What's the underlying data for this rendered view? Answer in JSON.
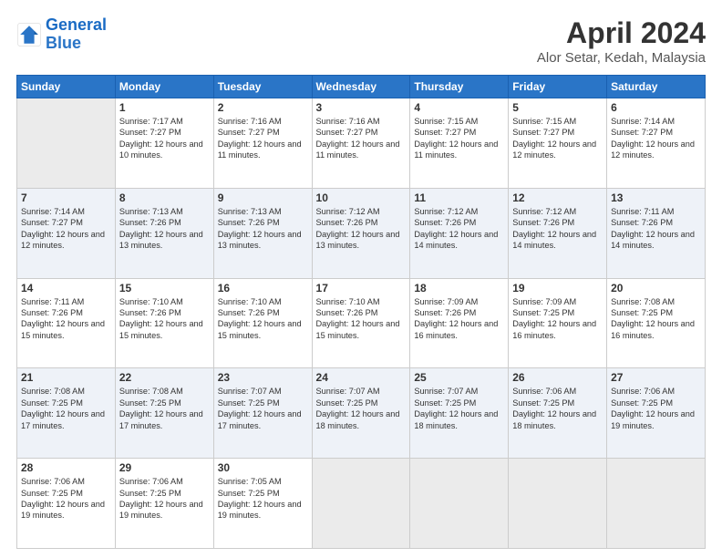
{
  "header": {
    "logo_general": "General",
    "logo_blue": "Blue",
    "title": "April 2024",
    "subtitle": "Alor Setar, Kedah, Malaysia"
  },
  "weekdays": [
    "Sunday",
    "Monday",
    "Tuesday",
    "Wednesday",
    "Thursday",
    "Friday",
    "Saturday"
  ],
  "weeks": [
    [
      {
        "day": "",
        "empty": true
      },
      {
        "day": "1",
        "sunrise": "7:17 AM",
        "sunset": "7:27 PM",
        "daylight": "12 hours and 10 minutes."
      },
      {
        "day": "2",
        "sunrise": "7:16 AM",
        "sunset": "7:27 PM",
        "daylight": "12 hours and 11 minutes."
      },
      {
        "day": "3",
        "sunrise": "7:16 AM",
        "sunset": "7:27 PM",
        "daylight": "12 hours and 11 minutes."
      },
      {
        "day": "4",
        "sunrise": "7:15 AM",
        "sunset": "7:27 PM",
        "daylight": "12 hours and 11 minutes."
      },
      {
        "day": "5",
        "sunrise": "7:15 AM",
        "sunset": "7:27 PM",
        "daylight": "12 hours and 12 minutes."
      },
      {
        "day": "6",
        "sunrise": "7:14 AM",
        "sunset": "7:27 PM",
        "daylight": "12 hours and 12 minutes."
      }
    ],
    [
      {
        "day": "7",
        "sunrise": "7:14 AM",
        "sunset": "7:27 PM",
        "daylight": "12 hours and 12 minutes."
      },
      {
        "day": "8",
        "sunrise": "7:13 AM",
        "sunset": "7:26 PM",
        "daylight": "12 hours and 13 minutes."
      },
      {
        "day": "9",
        "sunrise": "7:13 AM",
        "sunset": "7:26 PM",
        "daylight": "12 hours and 13 minutes."
      },
      {
        "day": "10",
        "sunrise": "7:12 AM",
        "sunset": "7:26 PM",
        "daylight": "12 hours and 13 minutes."
      },
      {
        "day": "11",
        "sunrise": "7:12 AM",
        "sunset": "7:26 PM",
        "daylight": "12 hours and 14 minutes."
      },
      {
        "day": "12",
        "sunrise": "7:12 AM",
        "sunset": "7:26 PM",
        "daylight": "12 hours and 14 minutes."
      },
      {
        "day": "13",
        "sunrise": "7:11 AM",
        "sunset": "7:26 PM",
        "daylight": "12 hours and 14 minutes."
      }
    ],
    [
      {
        "day": "14",
        "sunrise": "7:11 AM",
        "sunset": "7:26 PM",
        "daylight": "12 hours and 15 minutes."
      },
      {
        "day": "15",
        "sunrise": "7:10 AM",
        "sunset": "7:26 PM",
        "daylight": "12 hours and 15 minutes."
      },
      {
        "day": "16",
        "sunrise": "7:10 AM",
        "sunset": "7:26 PM",
        "daylight": "12 hours and 15 minutes."
      },
      {
        "day": "17",
        "sunrise": "7:10 AM",
        "sunset": "7:26 PM",
        "daylight": "12 hours and 15 minutes."
      },
      {
        "day": "18",
        "sunrise": "7:09 AM",
        "sunset": "7:26 PM",
        "daylight": "12 hours and 16 minutes."
      },
      {
        "day": "19",
        "sunrise": "7:09 AM",
        "sunset": "7:25 PM",
        "daylight": "12 hours and 16 minutes."
      },
      {
        "day": "20",
        "sunrise": "7:08 AM",
        "sunset": "7:25 PM",
        "daylight": "12 hours and 16 minutes."
      }
    ],
    [
      {
        "day": "21",
        "sunrise": "7:08 AM",
        "sunset": "7:25 PM",
        "daylight": "12 hours and 17 minutes."
      },
      {
        "day": "22",
        "sunrise": "7:08 AM",
        "sunset": "7:25 PM",
        "daylight": "12 hours and 17 minutes."
      },
      {
        "day": "23",
        "sunrise": "7:07 AM",
        "sunset": "7:25 PM",
        "daylight": "12 hours and 17 minutes."
      },
      {
        "day": "24",
        "sunrise": "7:07 AM",
        "sunset": "7:25 PM",
        "daylight": "12 hours and 18 minutes."
      },
      {
        "day": "25",
        "sunrise": "7:07 AM",
        "sunset": "7:25 PM",
        "daylight": "12 hours and 18 minutes."
      },
      {
        "day": "26",
        "sunrise": "7:06 AM",
        "sunset": "7:25 PM",
        "daylight": "12 hours and 18 minutes."
      },
      {
        "day": "27",
        "sunrise": "7:06 AM",
        "sunset": "7:25 PM",
        "daylight": "12 hours and 19 minutes."
      }
    ],
    [
      {
        "day": "28",
        "sunrise": "7:06 AM",
        "sunset": "7:25 PM",
        "daylight": "12 hours and 19 minutes."
      },
      {
        "day": "29",
        "sunrise": "7:06 AM",
        "sunset": "7:25 PM",
        "daylight": "12 hours and 19 minutes."
      },
      {
        "day": "30",
        "sunrise": "7:05 AM",
        "sunset": "7:25 PM",
        "daylight": "12 hours and 19 minutes."
      },
      {
        "day": "",
        "empty": true
      },
      {
        "day": "",
        "empty": true
      },
      {
        "day": "",
        "empty": true
      },
      {
        "day": "",
        "empty": true
      }
    ]
  ]
}
